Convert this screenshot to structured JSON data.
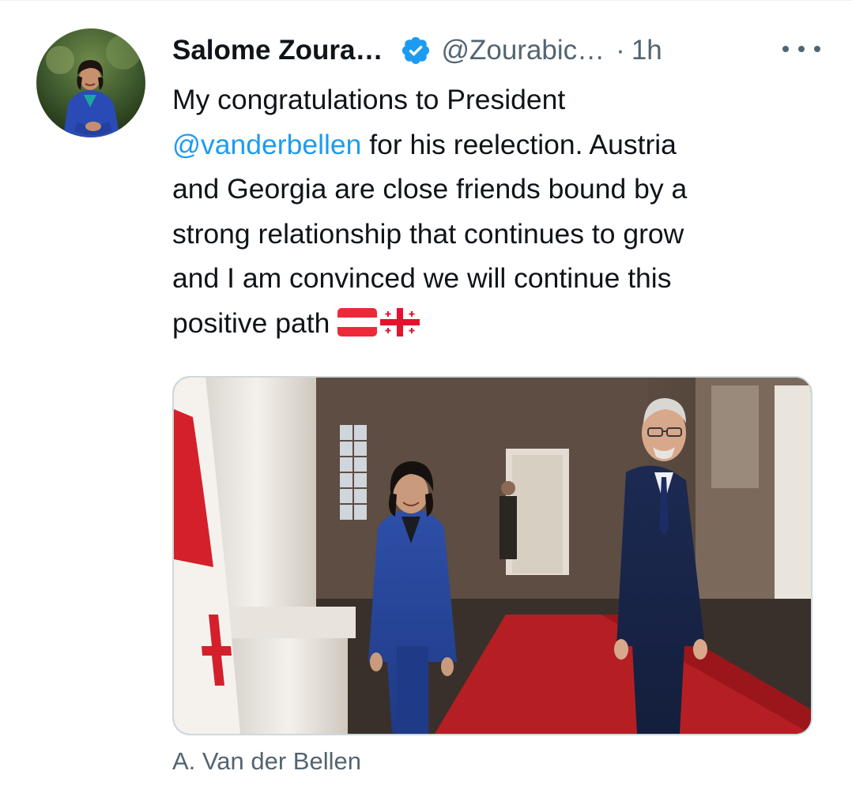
{
  "author": {
    "name": "Salome Zoura…",
    "handle": "@Zourabic…",
    "separator": "·",
    "time": "1h",
    "verified_icon": "verified-badge-icon",
    "avatar": "profile-photo"
  },
  "tweet": {
    "line1": "My congratulations to President",
    "mention": "@vanderbellen",
    "line2_rest": " for his reelection. Austria",
    "line3": "and Georgia are close friends bound by a",
    "line4": "strong relationship that continues to grow",
    "line5": "and I am convinced we will continue this",
    "line6": "positive path ",
    "flags": [
      "flag-austria-icon",
      "flag-georgia-icon"
    ]
  },
  "media": {
    "type": "photo"
  },
  "caption": "A. Van der Bellen",
  "colors": {
    "link": "#1d9bf0",
    "secondary_text": "#536471",
    "primary_text": "#0f1419",
    "verified": "#1d9bf0"
  }
}
